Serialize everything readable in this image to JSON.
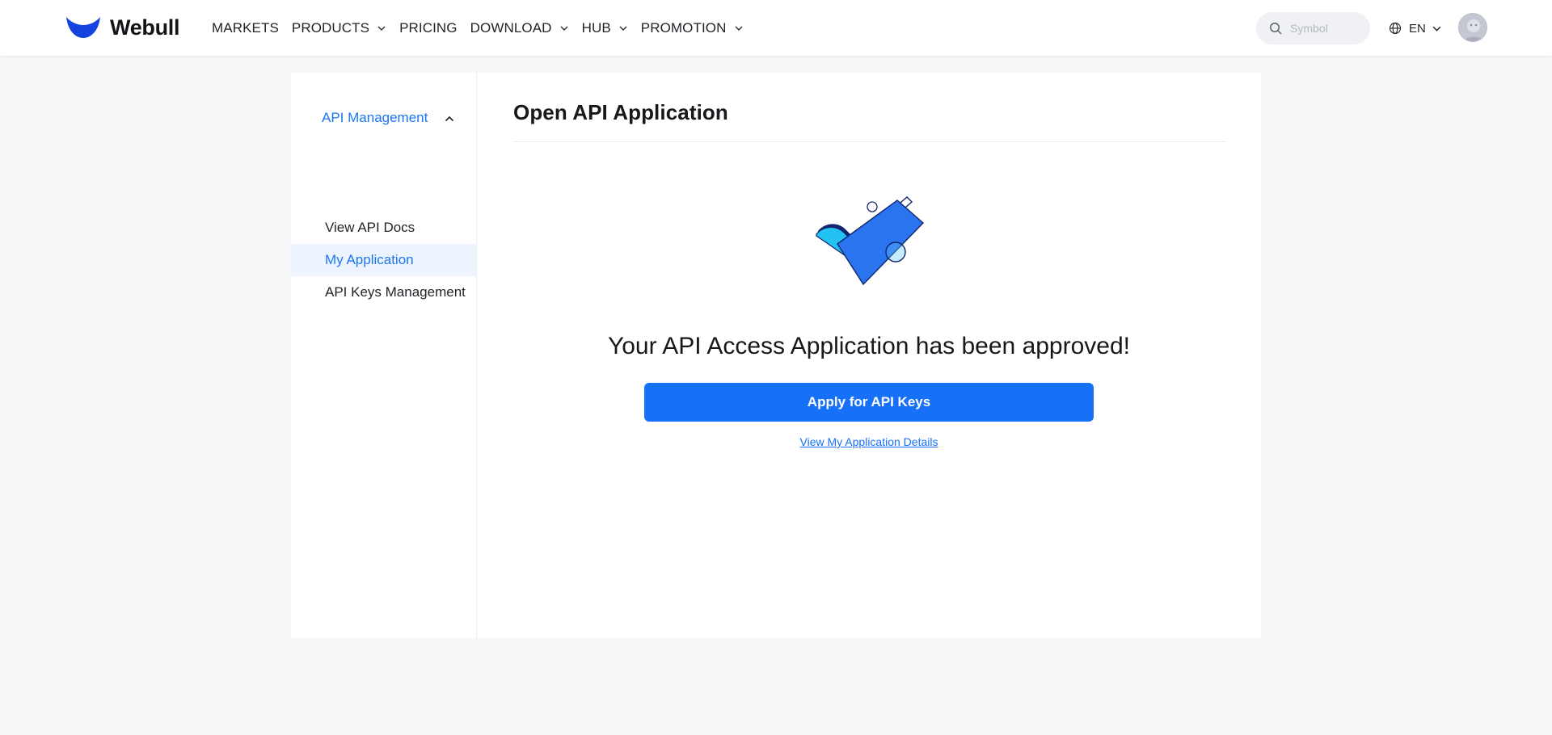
{
  "header": {
    "logo_text": "Webull",
    "nav": [
      {
        "label": "MARKETS",
        "has_dropdown": false
      },
      {
        "label": "PRODUCTS",
        "has_dropdown": true
      },
      {
        "label": "PRICING",
        "has_dropdown": false
      },
      {
        "label": "DOWNLOAD",
        "has_dropdown": true
      },
      {
        "label": "HUB",
        "has_dropdown": true
      },
      {
        "label": "PROMOTION",
        "has_dropdown": true
      }
    ],
    "search": {
      "placeholder": "Symbol",
      "value": "",
      "icon": "search-icon"
    },
    "language": {
      "label": "EN",
      "icon": "globe-icon"
    },
    "avatar": {
      "icon": "avatar"
    }
  },
  "sidebar": {
    "group_label": "API Management",
    "expanded": true,
    "items": [
      {
        "label": "View API Docs",
        "active": false
      },
      {
        "label": "My Application",
        "active": true
      },
      {
        "label": "API Keys Management",
        "active": false
      }
    ]
  },
  "main": {
    "title": "Open API Application",
    "illustration": "approved-checkmark-illustration",
    "headline": "Your API Access Application has been approved!",
    "primary_button": "Apply for API Keys",
    "details_link": "View My Application Details"
  },
  "colors": {
    "brand_blue": "#1671f8",
    "accent_blue": "#1b76f2",
    "active_bg": "#edf4fe",
    "page_bg": "#f6f7f9",
    "illustration_cyan": "#22c3f2",
    "illustration_navy": "#122670"
  }
}
